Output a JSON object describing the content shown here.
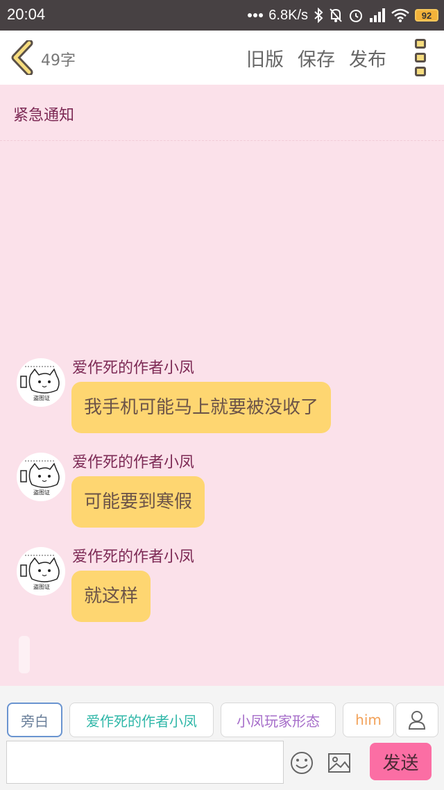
{
  "status_bar": {
    "time": "20:04",
    "network_speed": "6.8K/s",
    "battery": "92",
    "icons": [
      "dots-icon",
      "bluetooth-icon",
      "bell-off-icon",
      "alarm-icon",
      "signal-icon",
      "wifi-icon",
      "battery-icon"
    ]
  },
  "header": {
    "back_icon": "chevron-left-icon",
    "char_count": "49字",
    "old_version": "旧版",
    "save": "保存",
    "publish": "发布",
    "more_icon": "more-vertical-icon"
  },
  "story": {
    "title": "紧急通知"
  },
  "messages": [
    {
      "sender": "爱作死的作者小凤",
      "text": "我手机可能马上就要被没收了"
    },
    {
      "sender": "爱作死的作者小凤",
      "text": "可能要到寒假"
    },
    {
      "sender": "爱作死的作者小凤",
      "text": "就这样"
    }
  ],
  "roles": [
    {
      "label": "旁白",
      "color": "#6a7f9a",
      "selected": true
    },
    {
      "label": "爱作死的作者小凤",
      "color": "#2fb7a8",
      "selected": false
    },
    {
      "label": "小凤玩家形态",
      "color": "#a56cc9",
      "selected": false
    },
    {
      "label": "him",
      "color": "#f2a25a",
      "selected": false
    }
  ],
  "composer": {
    "placeholder": "",
    "send_label": "发送",
    "add_role_icon": "person-icon",
    "emoji_icon": "smiley-icon",
    "image_icon": "image-icon"
  },
  "colors": {
    "background": "#fbe1ea",
    "bubble": "#fed671",
    "name": "#7d2a55",
    "send": "#fb6ea4"
  }
}
